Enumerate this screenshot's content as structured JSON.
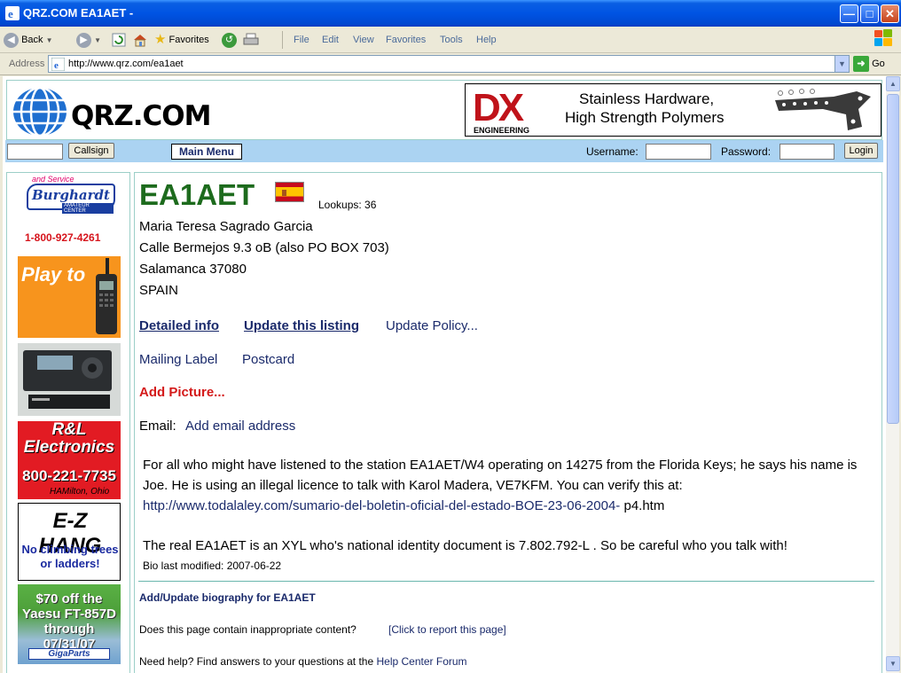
{
  "window": {
    "title": "QRZ.COM EA1AET -",
    "min_glyph": "—",
    "max_glyph": "□",
    "close_glyph": "✕"
  },
  "toolbar": {
    "back_label": "Back",
    "favorites_label": "Favorites",
    "menus": [
      "File",
      "Edit",
      "View",
      "Favorites",
      "Tools",
      "Help"
    ]
  },
  "address": {
    "label": "Address",
    "url": "http://www.qrz.com/ea1aet",
    "go_label": "Go"
  },
  "header": {
    "logo_text": "QRZ.COM",
    "banner": {
      "brand": "DX",
      "brand_sub": "ENGINEERING",
      "line1": "Stainless Hardware,",
      "line2": "High Strength Polymers"
    }
  },
  "nav": {
    "callsign_button": "Callsign",
    "main_menu": "Main Menu",
    "username_label": "Username:",
    "password_label": "Password:",
    "login_button": "Login"
  },
  "ads": {
    "burghardt": {
      "top_text": "and Service",
      "name": "Burghardt",
      "sub": "AMATEUR CENTER",
      "phone": "1-800-927-4261"
    },
    "play": {
      "text": "Play to"
    },
    "rl": {
      "name_line1": "R&L",
      "name_line2": "Electronics",
      "phone": "800-221-7735",
      "location": "HAMilton, Ohio"
    },
    "ezhang": {
      "title": "E-Z HANG",
      "sub_line1": "No climbing trees",
      "sub_line2": "or ladders!"
    },
    "gigaparts": {
      "line1": "$70 off the",
      "line2": "Yaesu FT-857D",
      "line3": "through 07/31/07",
      "logo": "GigaParts"
    }
  },
  "listing": {
    "callsign": "EA1AET",
    "lookups_label": "Lookups: 36",
    "name": "Maria Teresa Sagrado Garcia",
    "street": "Calle Bermejos 9.3 oB (also PO BOX 703)",
    "city": "Salamanca 37080",
    "country": "SPAIN",
    "links": {
      "detailed": "Detailed info",
      "update": "Update this listing",
      "policy": "Update Policy...",
      "mailing": "Mailing Label",
      "postcard": "Postcard",
      "add_picture": "Add Picture..."
    },
    "email_label": "Email:",
    "email_link": "Add email address"
  },
  "bio": {
    "para1_text": "For all who might have listened to the station EA1AET/W4 operating on 14275 from the Florida Keys; he says his name is Joe. He is using an illegal licence to talk with Karol Madera, VE7KFM. You can verify this at:",
    "para1_url": "http://www.todalaley.com/sumario-del-boletin-oficial-del-estado-BOE-23-06-2004-",
    "para1_tail": " p4.htm",
    "para2": "The real EA1AET is an XYL who's national identity document is 7.802.792-L . So be careful who you talk with!",
    "modified": "Bio last modified: 2007-06-22",
    "add_bio": "Add/Update biography for EA1AET",
    "report_question": "Does this page contain inappropriate content?",
    "report_link": "[Click to report this page]",
    "help_text": "Need help? Find answers to your questions at the ",
    "help_link": "Help Center Forum"
  },
  "colors": {
    "callsign_green": "#1d6b1d",
    "link_navy": "#1a2a6b",
    "add_picture_red": "#d41a1a",
    "nav_blue": "#abd3f2",
    "panel_border": "#9ccfc8"
  }
}
